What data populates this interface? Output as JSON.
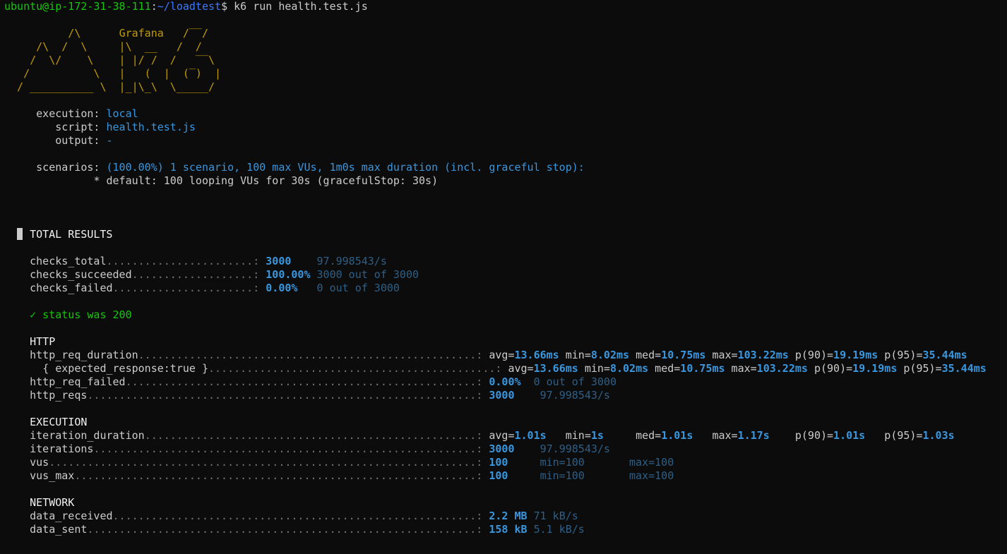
{
  "prompt": {
    "user_host": "ubuntu@ip-172-31-38-111",
    "path": "~/loadtest",
    "symbol": "$",
    "command": "k6 run health.test.js"
  },
  "logo_text": "Grafana",
  "run_info": {
    "execution_key": "execution:",
    "execution_value": "local",
    "script_key": "script:",
    "script_value": "health.test.js",
    "output_key": "output:",
    "output_value": "-",
    "scenarios_key": "scenarios:",
    "scenarios_value": "(100.00%) 1 scenario, 100 max VUs, 1m0s max duration (incl. graceful stop):",
    "scenario_detail": "* default: 100 looping VUs for 30s (gracefulStop: 30s)"
  },
  "total_results_title": "TOTAL RESULTS",
  "checks": [
    {
      "name": "checks_total",
      "value": "3000",
      "extra": "97.998543/s"
    },
    {
      "name": "checks_succeeded",
      "value": "100.00%",
      "extra": "3000 out of 3000"
    },
    {
      "name": "checks_failed",
      "value": "0.00%",
      "extra": "0 out of 3000"
    }
  ],
  "check_status": "✓ status was 200",
  "http": {
    "title": "HTTP",
    "req_duration": {
      "name": "http_req_duration",
      "avg": "13.66ms",
      "min": "8.02ms",
      "med": "10.75ms",
      "max": "103.22ms",
      "p90": "19.19ms",
      "p95": "35.44ms"
    },
    "expected_response": {
      "name": "{ expected_response:true }",
      "avg": "13.66ms",
      "min": "8.02ms",
      "med": "10.75ms",
      "max": "103.22ms",
      "p90": "19.19ms",
      "p95": "35.44ms"
    },
    "req_failed": {
      "name": "http_req_failed",
      "value": "0.00%",
      "extra": "0 out of 3000"
    },
    "reqs": {
      "name": "http_reqs",
      "value": "3000",
      "extra": "97.998543/s"
    }
  },
  "execution": {
    "title": "EXECUTION",
    "iteration_duration": {
      "name": "iteration_duration",
      "avg": "1.01s",
      "min": "1s",
      "med": "1.01s",
      "max": "1.17s",
      "p90": "1.01s",
      "p95": "1.03s"
    },
    "iterations": {
      "name": "iterations",
      "value": "3000",
      "extra": "97.998543/s"
    },
    "vus": {
      "name": "vus",
      "value": "100",
      "min": "min=100",
      "max": "max=100"
    },
    "vus_max": {
      "name": "vus_max",
      "value": "100",
      "min": "min=100",
      "max": "max=100"
    }
  },
  "network": {
    "title": "NETWORK",
    "data_received": {
      "name": "data_received",
      "value": "2.2 MB",
      "extra": "71 kB/s"
    },
    "data_sent": {
      "name": "data_sent",
      "value": "158 kB",
      "extra": "5.1 kB/s"
    }
  },
  "stat_labels": {
    "avg": "avg=",
    "min": "min=",
    "med": "med=",
    "max": "max=",
    "p90": "p(90)=",
    "p95": "p(95)="
  },
  "colors": {
    "background": "#0c0c0c",
    "foreground": "#cccccc",
    "prompt_user": "#16c60c",
    "prompt_path": "#3b78ff",
    "value": "#3a96dd",
    "dim_value": "#2f5f86",
    "logo": "#c19c00"
  }
}
